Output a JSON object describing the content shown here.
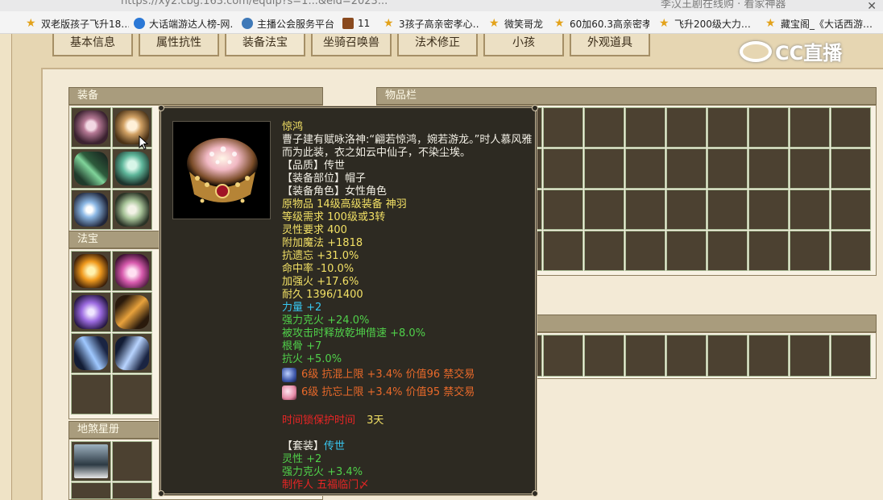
{
  "browser": {
    "url_fragment": "https://xy2.cbg.163.com/equip?s=1...&eid=2023...",
    "tab_title_fragment": "李汉王剧在线购 · 看家神器",
    "bookmarks": [
      {
        "label": "双老版孩子飞升18…",
        "icon": "star-icon"
      },
      {
        "label": "大话端游达人榜-网…",
        "icon": "globe-icon"
      },
      {
        "label": "主播公会服务平台",
        "icon": "globe-icon"
      },
      {
        "label": "11",
        "icon": "game-tile-icon"
      },
      {
        "label": "3孩子高亲密孝心…",
        "icon": "star-icon"
      },
      {
        "label": "微笑哥龙",
        "icon": "star-icon"
      },
      {
        "label": "60加60.3高亲密孝…",
        "icon": "star-icon"
      },
      {
        "label": "飞升200级大力…",
        "icon": "star-icon"
      },
      {
        "label": "藏宝阁_《大话西游…",
        "icon": "star-icon"
      }
    ],
    "close_glyph": "✕"
  },
  "tabs": [
    "基本信息",
    "属性抗性",
    "装备法宝",
    "坐骑召唤兽",
    "法术修正",
    "小孩",
    "外观道具"
  ],
  "active_tab": "装备法宝",
  "sections": {
    "equipment": "装备",
    "treasure": "法宝",
    "star_book": "地煞星册",
    "inventory": "物品栏"
  },
  "watermark": "CC直播",
  "tooltip": {
    "name": "惊鸿",
    "description": "曹子建有赋咏洛神:“翩若惊鸿，婉若游龙。”时人慕风雅而为此装，衣之如云中仙子，不染尘埃。",
    "quality": "【品质】传世",
    "slot": "【装备部位】帽子",
    "role": "【装备角色】女性角色",
    "base_lines": [
      "原物品 14级高级装备 神羽",
      "等级需求 100级或3转",
      "灵性要求 400"
    ],
    "stat_lines": [
      "附加魔法 +1818",
      "抗遗忘 +31.0%",
      "命中率 -10.0%",
      "加强火 +17.6%",
      "耐久 1396/1400"
    ],
    "blue_line": "力量 +2",
    "green_lines": [
      "强力克火 +24.0%",
      "被攻击时释放乾坤借速 +8.0%",
      "根骨 +7",
      "抗火 +5.0%"
    ],
    "gems": [
      {
        "text": "6级 抗混上限 +3.4% 价值96 禁交易",
        "color": "#3d56a8"
      },
      {
        "text": "6级 抗忘上限 +3.4% 价值95 禁交易",
        "color": "#e58aa6"
      }
    ],
    "protect_label": "时间锁保护时间",
    "protect_value": "3天",
    "set_label": "【套装】",
    "set_value": "传世",
    "set_lines": [
      "灵性 +2",
      "强力克火 +3.4%"
    ],
    "maker": "制作人 五福临门〆"
  },
  "colors": {
    "white": "#f3f0e6",
    "yellow": "#f2e065",
    "green": "#50d04a",
    "blue": "#38c7f0",
    "orange": "#e8692a",
    "red": "#e82525"
  }
}
